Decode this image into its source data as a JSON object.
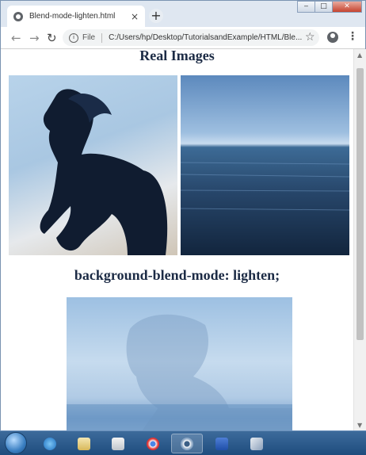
{
  "browser": {
    "tab_title": "Blend-mode-lighten.html",
    "tab_close": "×",
    "new_tab": "+",
    "window_controls": {
      "minimize": "‒",
      "maximize": "□",
      "close": "✕"
    },
    "nav": {
      "back": "←",
      "forward": "→",
      "reload": "↻"
    },
    "address": {
      "scheme_label": "File",
      "url": "C:/Users/hp/Desktop/TutorialsandExample/HTML/Ble..."
    },
    "star": "☆",
    "menu": "⋮"
  },
  "page": {
    "heading_real": "Real Images",
    "heading_blend": "background-blend-mode: lighten;",
    "images": [
      "horse-image",
      "sea-image",
      "blended-image"
    ]
  },
  "taskbar": {
    "items": [
      "start-orb",
      "internet-explorer-icon",
      "file-explorer-icon",
      "media-player-icon",
      "chrome-icon",
      "chrome-active-icon",
      "word-icon",
      "paint-icon"
    ]
  },
  "colors": {
    "heading": "#1c2b45",
    "taskbar": "#1f4d7e"
  }
}
